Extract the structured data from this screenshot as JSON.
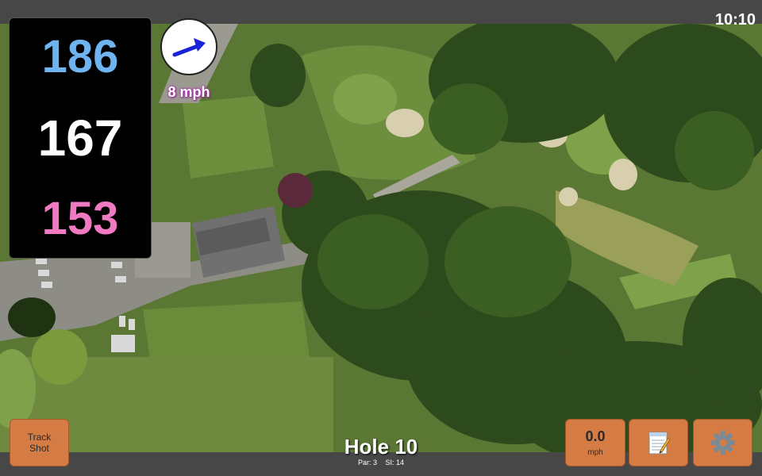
{
  "status": {
    "time": "10:10"
  },
  "distances": {
    "back": "186",
    "middle": "167",
    "front": "153"
  },
  "wind": {
    "speed": "8 mph",
    "icon": "wind-arrow-icon"
  },
  "buttons": {
    "track_shot": [
      "Track",
      "Shot"
    ],
    "speed_value": "0.0",
    "speed_unit": "mph",
    "notes_icon": "notepad-icon",
    "settings_icon": "gear-icon"
  },
  "hole": {
    "title": "Hole 10",
    "par": "Par: 3",
    "si": "SI: 14"
  },
  "colors": {
    "back": "#6fb4f0",
    "middle": "#ffffff",
    "front": "#f07ac2",
    "button": "#d47c44"
  }
}
